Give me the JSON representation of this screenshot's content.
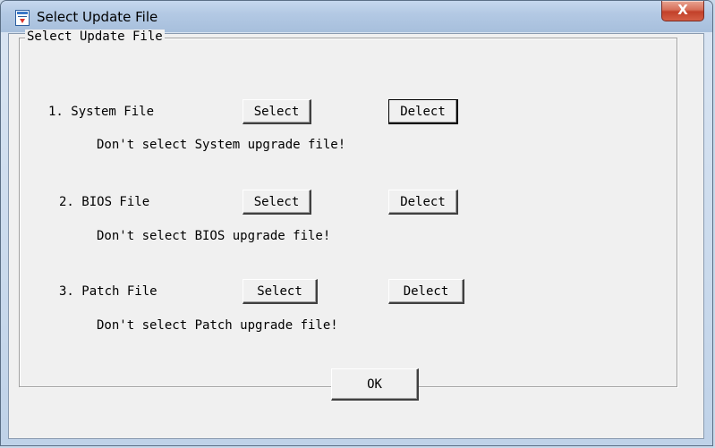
{
  "window": {
    "title": "Select Update File",
    "close_label": "X"
  },
  "group": {
    "label": "Select Update File"
  },
  "items": [
    {
      "label": "1. System File",
      "select_label": "Select",
      "delect_label": "Delect",
      "status": "Don't select System upgrade file!"
    },
    {
      "label": "2. BIOS File",
      "select_label": "Select",
      "delect_label": "Delect",
      "status": "Don't select BIOS upgrade file!"
    },
    {
      "label": "3. Patch File",
      "select_label": "Select",
      "delect_label": "Delect",
      "status": "Don't select Patch upgrade file!"
    }
  ],
  "ok_label": "OK",
  "icons": {
    "title": "document-update-icon",
    "close": "close-icon"
  }
}
